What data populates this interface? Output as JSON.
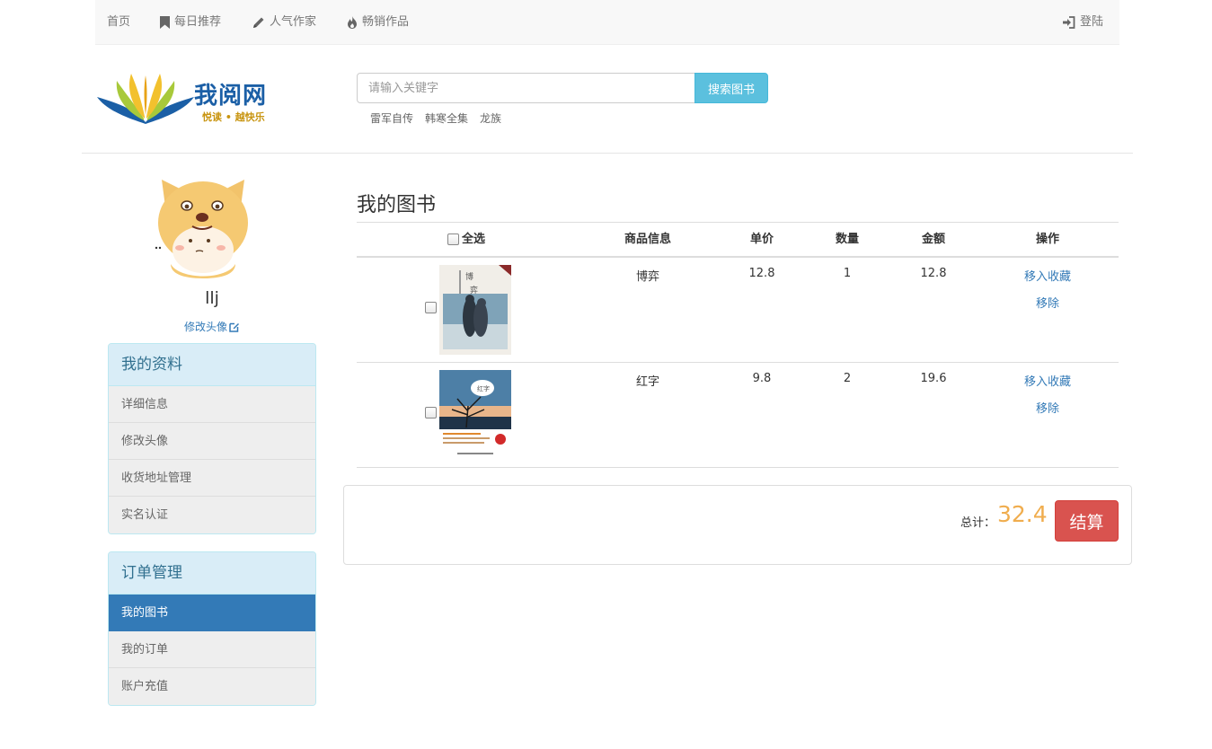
{
  "nav": {
    "home": "首页",
    "daily": "每日推荐",
    "authors": "人气作家",
    "bestsellers": "畅销作品",
    "login": "登陆"
  },
  "logo": {
    "title": "我阅网",
    "slogan": "悦读 • 越快乐"
  },
  "search": {
    "placeholder": "请输入关键字",
    "button": "搜索图书",
    "hot_words": [
      "雷军自传",
      "韩寒全集",
      "龙族"
    ]
  },
  "user": {
    "name": "llj",
    "edit_avatar": "修改头像"
  },
  "sidebar": {
    "profile": {
      "title": "我的资料",
      "items": [
        "详细信息",
        "修改头像",
        "收货地址管理",
        "实名认证"
      ]
    },
    "orders": {
      "title": "订单管理",
      "items": [
        "我的图书",
        "我的订单",
        "账户充值"
      ],
      "active": "我的图书"
    }
  },
  "main": {
    "title": "我的图书",
    "columns": {
      "select_all": "全选",
      "info": "商品信息",
      "price": "单价",
      "qty": "数量",
      "amount": "金额",
      "action": "操作"
    },
    "rows": [
      {
        "name": "博弈",
        "price": "12.8",
        "qty": "1",
        "amount": "12.8",
        "favorite": "移入收藏",
        "remove": "移除"
      },
      {
        "name": "红字",
        "price": "9.8",
        "qty": "2",
        "amount": "19.6",
        "favorite": "移入收藏",
        "remove": "移除"
      }
    ]
  },
  "summary": {
    "total_label": "总计：",
    "total_value": "32.4",
    "checkout": "结算"
  },
  "colors": {
    "primary": "#337ab7",
    "info": "#5bc0de",
    "danger": "#d9534f",
    "warning": "#f0ad4e",
    "panel_heading": "#d9edf7"
  }
}
